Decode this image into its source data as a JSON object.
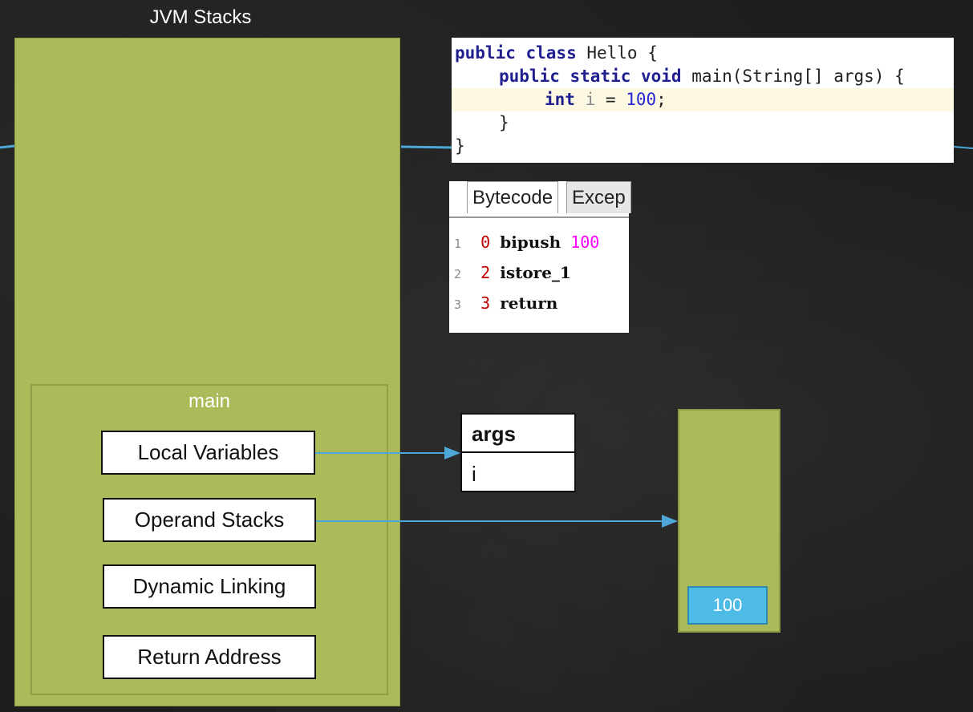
{
  "title": "JVM Stacks",
  "frame": {
    "label": "main",
    "items": [
      "Local Variables",
      "Operand Stacks",
      "Dynamic Linking",
      "Return Address"
    ]
  },
  "code": {
    "lines": [
      {
        "kw": "public class",
        "rest": " Hello {"
      },
      {
        "kw": "public static void",
        "rest": " main(String[] args) {"
      },
      {
        "kw": "int",
        "var": "i",
        "rest": " = ",
        "num": "100",
        "end": ";"
      },
      {
        "rest": "}"
      },
      {
        "rest": "}"
      }
    ]
  },
  "bytecode": {
    "tabs": [
      "Bytecode",
      "Excep"
    ],
    "rows": [
      {
        "line": "1",
        "offset": "0",
        "instr": "bipush",
        "arg": "100"
      },
      {
        "line": "2",
        "offset": "2",
        "instr": "istore_1",
        "arg": ""
      },
      {
        "line": "3",
        "offset": "3",
        "instr": "return",
        "arg": ""
      }
    ]
  },
  "local_variables": [
    "args",
    "i"
  ],
  "operand_stack": [
    "100"
  ],
  "colors": {
    "stack_green": "#abbb59",
    "arrow_blue": "#4da8d8",
    "operand_blue": "#4dbbe6"
  }
}
